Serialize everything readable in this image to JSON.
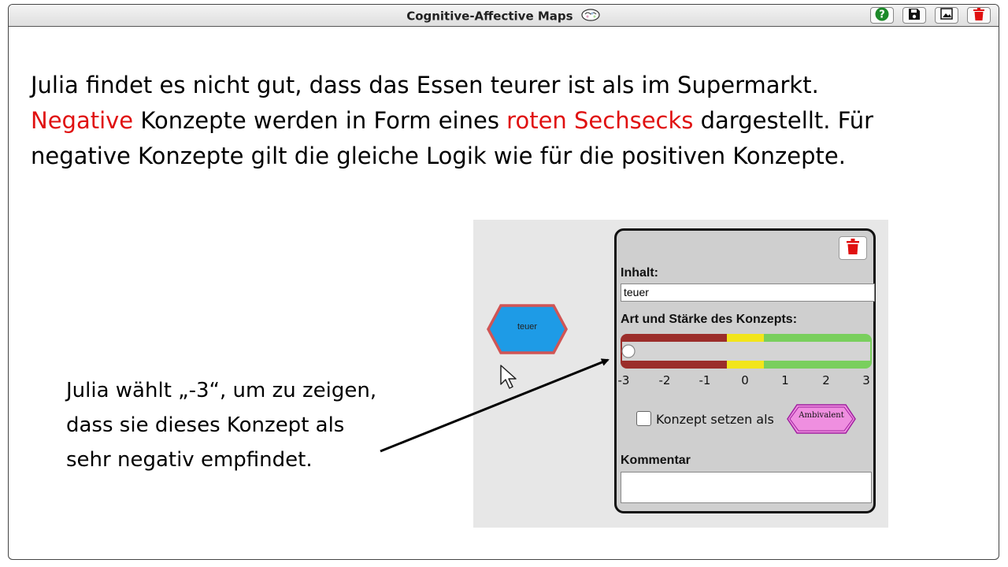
{
  "app": {
    "title": "Cognitive-Affective Maps",
    "toolbar": {
      "help_icon": "help-icon",
      "save_icon": "save-icon",
      "image_icon": "image-icon",
      "delete_icon": "trash-icon"
    }
  },
  "intro": {
    "line1": "Julia findet es nicht gut, dass das Essen teurer ist als im Supermarkt.",
    "line2_red1": "Negative",
    "line2_mid": " Konzepte werden in Form eines ",
    "line2_red2": "roten Sechsecks",
    "line2_end": " dargestellt. Für",
    "line3": "negative Konzepte gilt die gleiche Logik wie für die positiven Konzepte."
  },
  "caption": "Julia wählt „-3“, um zu zeigen, dass sie dieses Konzept als sehr negativ empfindet.",
  "node": {
    "label": "teuer",
    "fill": "#1e9be6",
    "border": "#d05555"
  },
  "panel": {
    "content_label": "Inhalt:",
    "content_value": "teuer",
    "strength_label": "Art und Stärke des Konzepts:",
    "slider_value": -3,
    "ticks": [
      "-3",
      "-2",
      "-1",
      "0",
      "1",
      "2",
      "3"
    ],
    "checkbox_label": "Konzept setzen als",
    "checkbox_checked": false,
    "ambivalent_label": "Ambivalent",
    "comment_label": "Kommentar",
    "comment_value": ""
  },
  "colors": {
    "negative": "#9b2d2a",
    "neutral": "#f2e51b",
    "positive": "#79cf5d",
    "ambivalent_fill": "#ef8fe0",
    "ambivalent_border": "#a020a0",
    "delete": "#e01010"
  }
}
